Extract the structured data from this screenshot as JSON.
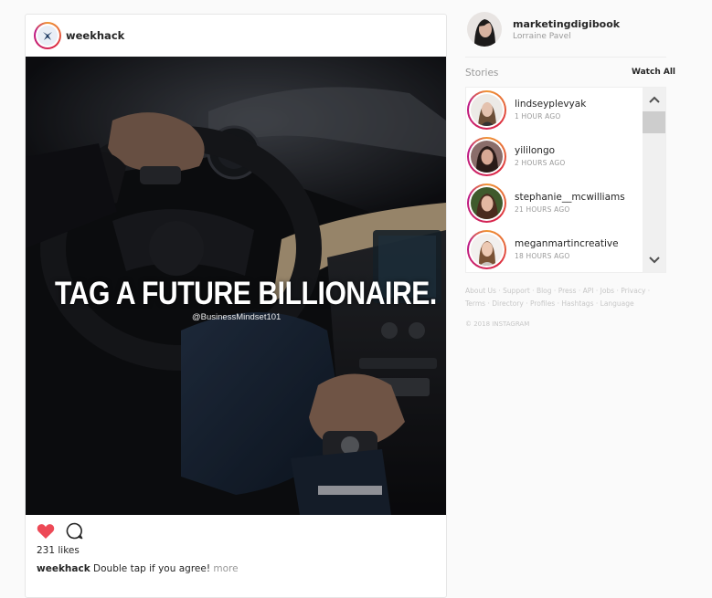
{
  "post": {
    "username": "weekhack",
    "image_text": "TAG A FUTURE BILLIONAIRE.",
    "image_handle": "@BusinessMindset101",
    "likes": "231 likes",
    "caption_user": "weekhack",
    "caption_text": " Double tap if you agree! ",
    "more_label": "more",
    "liked": true,
    "like_color": "#ed4956"
  },
  "sidebar": {
    "profile": {
      "username": "marketingdigibook",
      "full_name": "Lorraine Pavel"
    },
    "stories_title": "Stories",
    "watch_all": "Watch All",
    "stories": [
      {
        "username": "lindseyplevyak",
        "time": "1 HOUR AGO"
      },
      {
        "username": "yililongo",
        "time": "2 HOURS AGO"
      },
      {
        "username": "stephanie__mcwilliams",
        "time": "21 HOURS AGO"
      },
      {
        "username": "meganmartincreative",
        "time": "18 HOURS AGO"
      }
    ],
    "footer_links": [
      "About Us",
      "Support",
      "Blog",
      "Press",
      "API",
      "Jobs",
      "Privacy",
      "Terms",
      "Directory",
      "Profiles",
      "Hashtags",
      "Language"
    ],
    "copyright": "© 2018 INSTAGRAM"
  },
  "icons": {
    "like": "heart-icon",
    "comment": "comment-icon",
    "scroll_up": "chevron-up-icon",
    "scroll_down": "chevron-down-icon"
  }
}
